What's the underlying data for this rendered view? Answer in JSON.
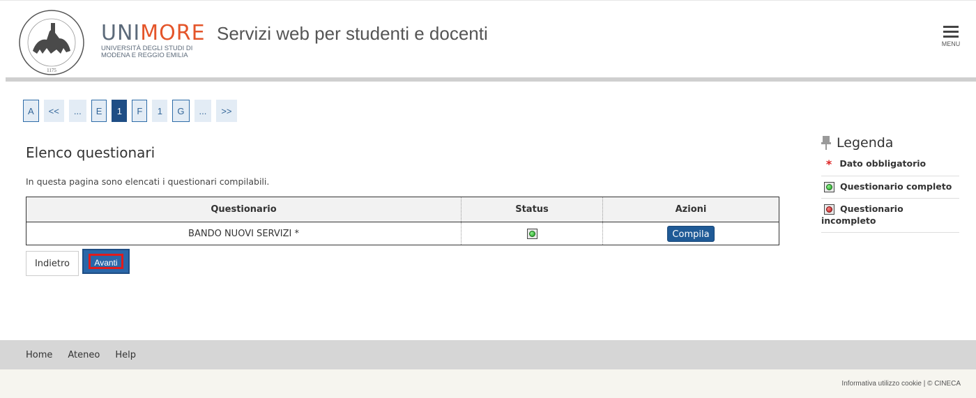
{
  "header": {
    "brand_uni": "UNI",
    "brand_more": "MORE",
    "brand_sub_1": "UNIVERSITÀ DEGLI STUDI DI",
    "brand_sub_2": "MODENA E REGGIO EMILIA",
    "seal_text": "STUDIORUM MUTINENSIS ET REGIENSIS UNIVERSITAS",
    "seal_year": "1175",
    "site_title": "Servizi web per studenti e docenti",
    "menu_label": "MENU"
  },
  "pagination": [
    "A",
    "<<",
    "...",
    "E",
    "1",
    "F",
    "1",
    "G",
    "...",
    ">>"
  ],
  "main": {
    "title": "Elenco questionari",
    "intro": "In questa pagina sono elencati i questionari compilabili.",
    "table": {
      "headers": [
        "Questionario",
        "Status",
        "Azioni"
      ],
      "rows": [
        {
          "questionario": "BANDO NUOVI SERVIZI *",
          "status": "green-led-icon",
          "azione": "Compila"
        }
      ]
    },
    "back_label": "Indietro",
    "next_label": "Avanti"
  },
  "legend": {
    "title": "Legenda",
    "items": [
      {
        "icon": "required-star-icon",
        "label": "Dato obbligatorio"
      },
      {
        "icon": "green-led-icon",
        "label": "Questionario completo"
      },
      {
        "icon": "red-led-icon",
        "label": "Questionario incompleto"
      }
    ]
  },
  "footer": {
    "links": [
      "Home",
      "Ateneo",
      "Help"
    ],
    "bottom": "Informativa utilizzo cookie | © CINECA"
  },
  "colors": {
    "brand_more": "#e4552a",
    "primary_button": "#1f5a96",
    "highlight": "#e01b1b"
  }
}
